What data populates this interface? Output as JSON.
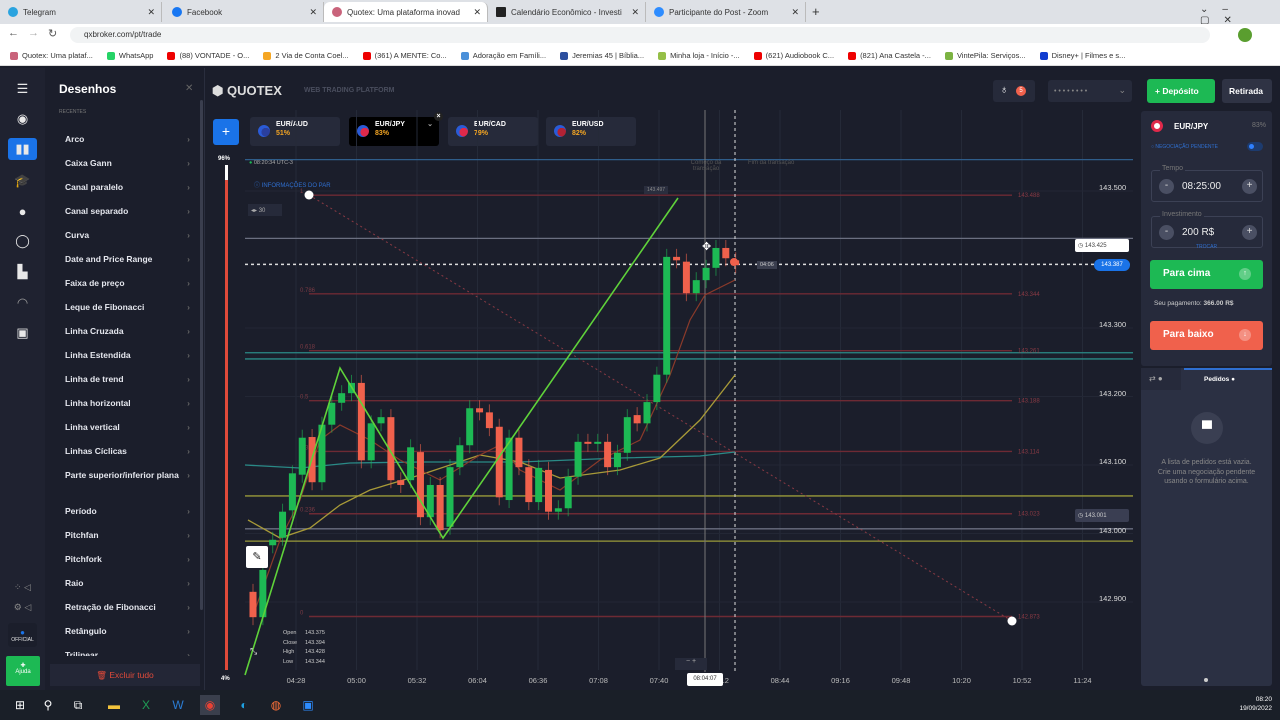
{
  "browser": {
    "tabs": [
      {
        "label": "Telegram",
        "color": "#2aa3df"
      },
      {
        "label": "Facebook",
        "color": "#1877f2"
      },
      {
        "label": "Quotex: Uma plataforma inovad",
        "color": "#c9637b"
      },
      {
        "label": "Calendário Econômico - Investi",
        "color": "#222"
      },
      {
        "label": "Participante do Post - Zoom",
        "color": "#2d8cff"
      }
    ],
    "new_tab": "+",
    "url": "qxbroker.com/pt/trade",
    "bookmarks": [
      {
        "label": "Quotex: Uma plataf...",
        "color": "#c9637b"
      },
      {
        "label": "WhatsApp",
        "color": "#25d366"
      },
      {
        "label": "(88) VONTADE - O...",
        "color": "#e00"
      },
      {
        "label": "2 Via de Conta Coel...",
        "color": "#f5a623"
      },
      {
        "label": "(361) A MENTE: Co...",
        "color": "#e00"
      },
      {
        "label": "Adoração em Famíli...",
        "color": "#4a90d9"
      },
      {
        "label": "Jeremias 45 | Bíblia...",
        "color": "#2c4f9e"
      },
      {
        "label": "Minha loja - Início -...",
        "color": "#95bf47"
      },
      {
        "label": "(621) Audiobook C...",
        "color": "#e00"
      },
      {
        "label": "(821) Ana Castela -...",
        "color": "#e00"
      },
      {
        "label": "VintePila: Serviços...",
        "color": "#7cb342"
      },
      {
        "label": "Disney+ | Filmes e s...",
        "color": "#113ccf"
      }
    ]
  },
  "header": {
    "brand": "QUOTEX",
    "subtitle": "WEB TRADING PLATFORM",
    "balance_placeholder": "• • • • • • • •",
    "deposit": "Depósito",
    "withdraw": "Retirada",
    "notif_count": "5"
  },
  "drawings": {
    "title": "Desenhos",
    "section": "RECENTES",
    "items": [
      "Arco",
      "Caixa Gann",
      "Canal paralelo",
      "Canal separado",
      "Curva",
      "Date and Price Range",
      "Faixa de preço",
      "Leque de Fibonacci",
      "Linha Cruzada",
      "Linha Estendida",
      "Linha de trend",
      "Linha horizontal",
      "Linha vertical",
      "Linhas Cíclicas",
      "Parte superior/inferior plana",
      "Período",
      "Pitchfan",
      "Pitchfork",
      "Raio",
      "Retração de Fibonacci",
      "Retângulo",
      "Trilinear"
    ],
    "delete_all": "Excluir tudo",
    "help": "Ajuda",
    "official": "OFFICIAL"
  },
  "pairs": [
    {
      "name": "EUR/AUD",
      "pct": "51%",
      "active": false
    },
    {
      "name": "EUR/JPY",
      "pct": "83%",
      "active": true
    },
    {
      "name": "EUR/CAD",
      "pct": "79%",
      "active": false
    },
    {
      "name": "EUR/USD",
      "pct": "82%",
      "active": false
    }
  ],
  "chart_info": {
    "clock": "08:20:34 UTC-3",
    "pair_info": "INFORMAÇÕES DO PAR",
    "timeframe": "30",
    "sentiment_up": "96%",
    "sentiment_down": "4%",
    "trade_start": "Começo da transação",
    "trade_end": "Fim da transação",
    "cursor_time": "08:04:07",
    "current_price": "143.387",
    "timer": "04:06",
    "alert_top": "143.425",
    "alert_bottom": "143.001",
    "fib_top_tag": "143.497",
    "ohlc": [
      {
        "label": "Open",
        "value": "143.375"
      },
      {
        "label": "Close",
        "value": "143.394"
      },
      {
        "label": "High",
        "value": "143.428"
      },
      {
        "label": "Low",
        "value": "143.344"
      }
    ]
  },
  "chart_data": {
    "type": "candlestick",
    "title": "EUR/JPY",
    "ylim": [
      142.84,
      143.54
    ],
    "y_ticks": [
      "143.500",
      "143.300",
      "143.200",
      "143.100",
      "143.000",
      "142.900"
    ],
    "y_tick_values": [
      143.5,
      143.3,
      143.2,
      143.1,
      143.0,
      142.9
    ],
    "x_ticks": [
      "04:28",
      "05:00",
      "05:32",
      "06:04",
      "06:36",
      "07:08",
      "07:40",
      "08:12",
      "08:44",
      "09:16",
      "09:48",
      "10:20",
      "10:52",
      "11:24"
    ],
    "candles": [
      [
        142.909,
        142.872
      ],
      [
        142.872,
        142.941
      ],
      [
        142.977,
        142.985
      ],
      [
        142.988,
        143.026
      ],
      [
        143.028,
        143.082
      ],
      [
        143.08,
        143.134
      ],
      [
        143.135,
        143.069
      ],
      [
        143.069,
        143.153
      ],
      [
        143.153,
        143.185
      ],
      [
        143.185,
        143.199
      ],
      [
        143.199,
        143.214
      ],
      [
        143.214,
        143.101
      ],
      [
        143.101,
        143.155
      ],
      [
        143.155,
        143.164
      ],
      [
        143.164,
        143.072
      ],
      [
        143.072,
        143.065
      ],
      [
        143.072,
        143.12
      ],
      [
        143.113,
        143.018
      ],
      [
        143.018,
        143.065
      ],
      [
        143.065,
        142.999
      ],
      [
        143.004,
        143.091
      ],
      [
        143.091,
        143.123
      ],
      [
        143.123,
        143.177
      ],
      [
        143.177,
        143.171
      ],
      [
        143.171,
        143.148
      ],
      [
        143.15,
        143.047
      ],
      [
        143.043,
        143.134
      ],
      [
        143.134,
        143.091
      ],
      [
        143.091,
        143.04
      ],
      [
        143.04,
        143.09
      ],
      [
        143.087,
        143.026
      ],
      [
        143.026,
        143.031
      ],
      [
        143.031,
        143.077
      ],
      [
        143.077,
        143.128
      ],
      [
        143.128,
        143.126
      ],
      [
        143.126,
        143.128
      ],
      [
        143.128,
        143.091
      ],
      [
        143.091,
        143.112
      ],
      [
        143.112,
        143.164
      ],
      [
        143.167,
        143.155
      ],
      [
        143.155,
        143.186
      ],
      [
        143.186,
        143.226
      ],
      [
        143.226,
        143.398
      ],
      [
        143.398,
        143.393
      ],
      [
        143.391,
        143.345
      ],
      [
        143.345,
        143.364
      ],
      [
        143.364,
        143.382
      ],
      [
        143.382,
        143.411
      ],
      [
        143.411,
        143.396
      ],
      [
        143.393,
        143.386
      ]
    ],
    "fibonacci": [
      {
        "level": "1",
        "price": "143.488"
      },
      {
        "level": "0.786",
        "price": "143.344"
      },
      {
        "level": "0.618",
        "price": "143.261"
      },
      {
        "level": "0.5",
        "price": "143.188"
      },
      {
        "level": "0.382",
        "price": "143.114"
      },
      {
        "level": "0.236",
        "price": "143.023"
      },
      {
        "level": "0",
        "price": "142.873"
      }
    ],
    "horizontal_lines": [
      {
        "price": 143.54,
        "color": "#2f5d8a"
      },
      {
        "price": 143.425,
        "color": "#6b6f80"
      },
      {
        "price": 143.387,
        "color": "#dddddd",
        "dashed": true
      },
      {
        "price": 143.258,
        "color": "#2a8a87"
      },
      {
        "price": 143.249,
        "color": "#2a8a87"
      },
      {
        "price": 143.049,
        "color": "#9a9a3a"
      },
      {
        "price": 143.001,
        "color": "#6b6f80"
      },
      {
        "price": 142.983,
        "color": "#9a9a3a"
      }
    ]
  },
  "trade_panel": {
    "pair": "EUR/JPY",
    "pct": "83%",
    "pending": "NEGOCIAÇÃO PENDENTE",
    "time_label": "Tempo",
    "time_value": "08:25:00",
    "invest_label": "Investimento",
    "invest_value": "200 R$",
    "switch": "TROCAR",
    "up": "Para cima",
    "payout_label": "Seu pagamento:",
    "payout_value": "366.00 R$",
    "down": "Para baixo"
  },
  "orders": {
    "title": "Pedidos",
    "empty1": "A lista de pedidos está vazia.",
    "empty2": "Crie uma negociação pendente usando o formulário acima."
  },
  "taskbar": {
    "time": "08:20",
    "date": "19/09/2022"
  },
  "colors": {
    "green": "#1db954",
    "red": "#f0614c",
    "accent": "#1a73e8"
  }
}
